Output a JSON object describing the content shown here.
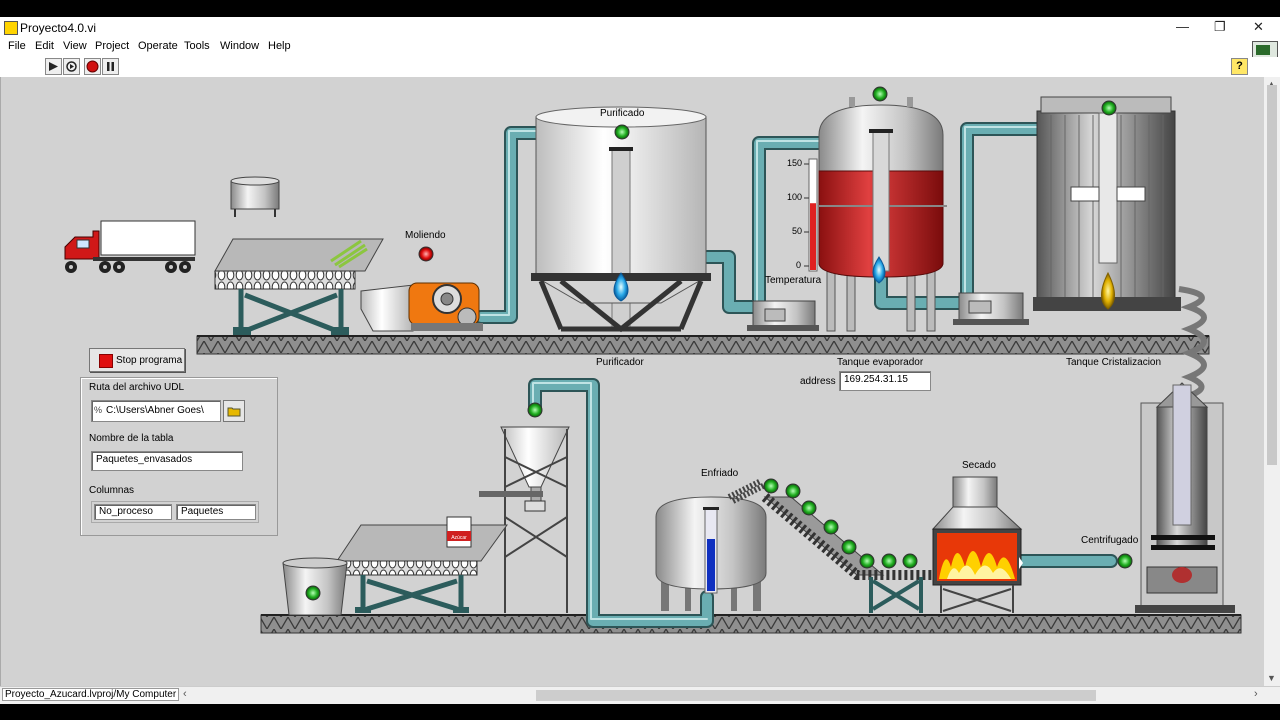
{
  "window": {
    "title": "Proyecto4.0.vi",
    "controls": [
      "—",
      "❐",
      "✕"
    ]
  },
  "menu": [
    "File",
    "Edit",
    "View",
    "Project",
    "Operate",
    "Tools",
    "Window",
    "Help"
  ],
  "toolbar": {
    "run_icon": "run-arrow-icon",
    "run_continuous_icon": "run-continuously-icon",
    "abort_icon": "abort-icon",
    "pause_icon": "pause-icon",
    "help_label": "?"
  },
  "process": {
    "purificado": "Purificado",
    "moliendo": "Moliendo",
    "purificador": "Purificador",
    "temperatura": "Temperatura",
    "tanque_evaporador": "Tanque evaporador",
    "tanque_cristalizacion": "Tanque Cristalizacion",
    "enfriado": "Enfriado",
    "secado": "Secado",
    "centrifugado": "Centrifugado",
    "temp_scale": [
      "150",
      "100",
      "50",
      "0"
    ],
    "temperature_level": 0.63,
    "bag_text": "Azúcar"
  },
  "controls": {
    "stop_label": "Stop programa",
    "address_label": "address",
    "address_value": "169.254.31.15",
    "udl_label": "Ruta del archivo UDL",
    "udl_value": "C:\\Users\\Abner Goes\\",
    "path_prefix": "%",
    "table_label": "Nombre de la tabla",
    "table_value": "Paquetes_envasados",
    "columns_label": "Columnas",
    "columns": [
      "No_proceso",
      "Paquetes"
    ]
  },
  "status": {
    "path": "Proyecto_Azucard.lvproj/My Computer"
  },
  "colors": {
    "panel": "#d2d2d2",
    "pipe": "#5f9ea0",
    "led_on": "#2ebd2e",
    "led_red": "#e01010",
    "tank_liquid": "#c0282a",
    "thermo": "#e02020"
  }
}
